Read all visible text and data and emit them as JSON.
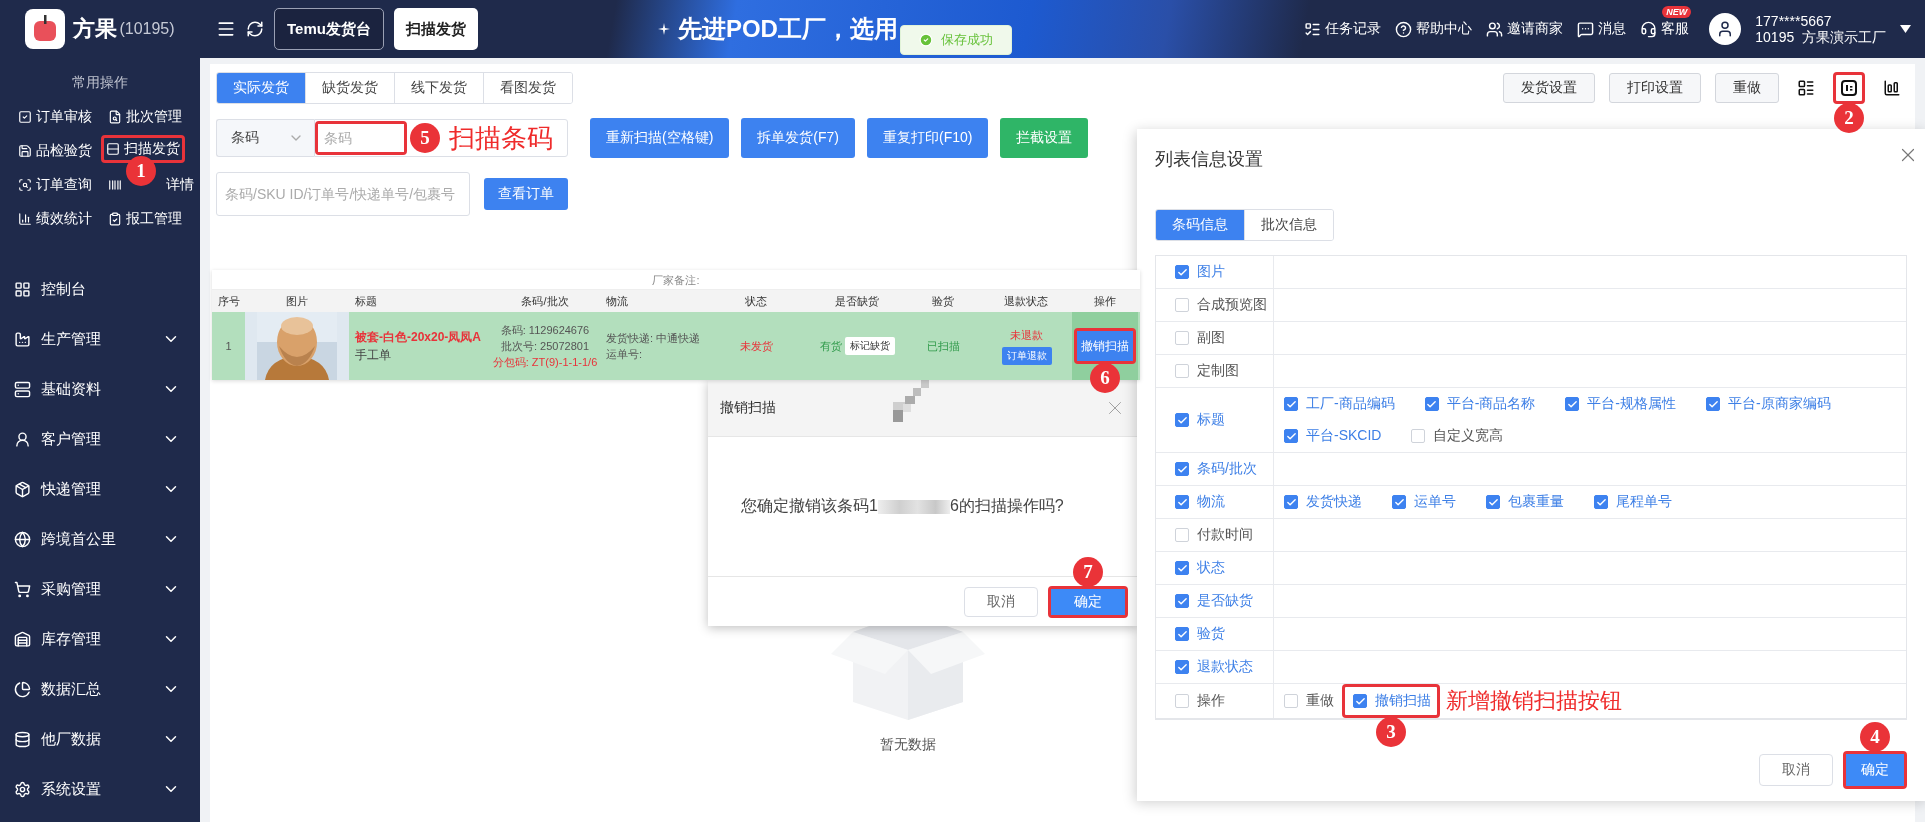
{
  "sidebar": {
    "logo_text": "方果",
    "account_id": "(10195)",
    "quick_title": "常用操作",
    "quick_actions": [
      {
        "label": "订单审核"
      },
      {
        "label": "批次管理"
      },
      {
        "label": "品检验货"
      },
      {
        "label": "扫描发货",
        "marker": "1"
      },
      {
        "label": "订单查询"
      },
      {
        "label": "详情"
      },
      {
        "label": "绩效统计"
      },
      {
        "label": "报工管理"
      }
    ],
    "menu": [
      {
        "label": "控制台",
        "expandable": false
      },
      {
        "label": "生产管理",
        "expandable": true
      },
      {
        "label": "基础资料",
        "expandable": true
      },
      {
        "label": "客户管理",
        "expandable": true
      },
      {
        "label": "快递管理",
        "expandable": true
      },
      {
        "label": "跨境首公里",
        "expandable": true
      },
      {
        "label": "采购管理",
        "expandable": true
      },
      {
        "label": "库存管理",
        "expandable": true
      },
      {
        "label": "数据汇总",
        "expandable": true
      },
      {
        "label": "他厂数据",
        "expandable": true
      },
      {
        "label": "系统设置",
        "expandable": true
      }
    ]
  },
  "topbar": {
    "tabs": [
      {
        "label": "Temu发货台",
        "selected": false
      },
      {
        "label": "扫描发货",
        "selected": true
      }
    ],
    "banner": "先进POD工厂，选用",
    "toast": "保存成功",
    "links": [
      {
        "label": "任务记录"
      },
      {
        "label": "帮助中心"
      },
      {
        "label": "邀请商家"
      },
      {
        "label": "消息"
      },
      {
        "label": "客服",
        "badge": "NEW"
      }
    ],
    "user": {
      "phone": "177****5667",
      "org": "10195  方果演示工厂"
    }
  },
  "ship_tabs": [
    {
      "label": "实际发货",
      "selected": true
    },
    {
      "label": "缺货发货",
      "selected": false
    },
    {
      "label": "线下发货",
      "selected": false
    },
    {
      "label": "看图发货",
      "selected": false
    }
  ],
  "toolbar_buttons": [
    "发货设置",
    "打印设置",
    "重做"
  ],
  "settings_icon_marker": "2",
  "scan": {
    "type_select": "条码",
    "input_placeholder": "条码",
    "marker": "5",
    "note": "扫描条码",
    "buttons": [
      {
        "label": "重新扫描(空格键)",
        "kind": "primary"
      },
      {
        "label": "拆单发货(F7)",
        "kind": "primary"
      },
      {
        "label": "重复打印(F10)",
        "kind": "primary"
      },
      {
        "label": "拦截设置",
        "kind": "success"
      }
    ]
  },
  "lookup": {
    "placeholder": "条码/SKU ID/订单号/快递单号/包裹号",
    "button": "查看订单"
  },
  "empty_text": "暂无数据",
  "table_clip": {
    "remark": "厂家备注:",
    "columns": [
      "序号",
      "图片",
      "标题",
      "条码/批次",
      "物流",
      "状态",
      "是否缺货",
      "验货",
      "退款状态",
      "操作"
    ],
    "row": {
      "index": "1",
      "title": "被套-白色-20x20-凤凤A",
      "subtitle": "手工单",
      "barcode": "条码: 1129624676",
      "batch": "批次号: 25072801",
      "package": "分包码: ZT(9)-1-1-1/6",
      "carrier": "发货快递: 中通快递",
      "tracking": "运单号:",
      "status": "未发货",
      "stock": "有货",
      "stock_button": "标记缺货",
      "inspection": "已扫描",
      "refund": "未退款",
      "refund_button": "订单退款",
      "action": "撤销扫描",
      "action_marker": "6"
    }
  },
  "confirm_dialog": {
    "title": "撤销扫描",
    "message_before": "您确定撤销该条码1",
    "message_after": "6的扫描操作吗?",
    "cancel": "取消",
    "ok": "确定",
    "ok_marker": "7"
  },
  "settings_panel": {
    "title": "列表信息设置",
    "tabs": [
      {
        "label": "条码信息",
        "selected": true
      },
      {
        "label": "批次信息",
        "selected": false
      }
    ],
    "rows": [
      {
        "label": "图片",
        "checked": true
      },
      {
        "label": "合成预览图",
        "checked": false
      },
      {
        "label": "副图",
        "checked": false
      },
      {
        "label": "定制图",
        "checked": false
      },
      {
        "label": "标题",
        "checked": true,
        "options": [
          {
            "label": "工厂-商品编码",
            "checked": true
          },
          {
            "label": "平台-商品名称",
            "checked": true
          },
          {
            "label": "平台-规格属性",
            "checked": true
          },
          {
            "label": "平台-原商家编码",
            "checked": true
          },
          {
            "label": "平台-SKCID",
            "checked": true
          },
          {
            "label": "自定义宽高",
            "checked": false
          }
        ]
      },
      {
        "label": "条码/批次",
        "checked": true
      },
      {
        "label": "物流",
        "checked": true,
        "options": [
          {
            "label": "发货快递",
            "checked": true
          },
          {
            "label": "运单号",
            "checked": true
          },
          {
            "label": "包裹重量",
            "checked": true
          },
          {
            "label": "尾程单号",
            "checked": true
          }
        ]
      },
      {
        "label": "付款时间",
        "checked": false
      },
      {
        "label": "状态",
        "checked": true
      },
      {
        "label": "是否缺货",
        "checked": true
      },
      {
        "label": "验货",
        "checked": true
      },
      {
        "label": "退款状态",
        "checked": true
      },
      {
        "label": "操作",
        "checked": false,
        "options": [
          {
            "label": "重做",
            "checked": false
          },
          {
            "label": "撤销扫描",
            "checked": true,
            "marker": "3"
          }
        ]
      }
    ],
    "note": "新增撤销扫描按钮",
    "cancel": "取消",
    "ok": "确定",
    "ok_marker": "4"
  }
}
